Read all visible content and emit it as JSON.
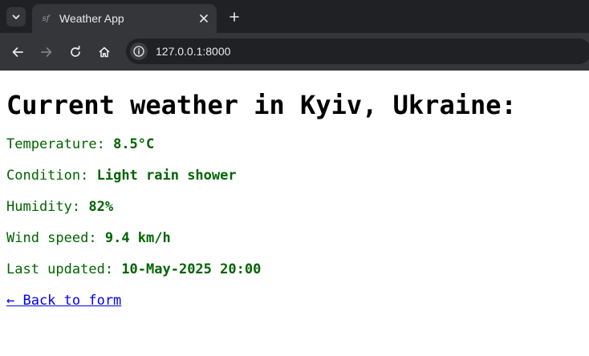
{
  "browser": {
    "tab_title": "Weather App",
    "favicon_text": "sf",
    "url": "127.0.0.1:8000",
    "icons": {
      "tab_search": "chevron-down-icon",
      "tab_close": "close-icon",
      "new_tab": "plus-icon",
      "back": "arrow-left-icon",
      "forward": "arrow-right-icon",
      "reload": "reload-icon",
      "home": "home-icon",
      "site_info": "info-icon"
    }
  },
  "page": {
    "heading": "Current weather in Kyiv, Ukraine:",
    "fields": [
      {
        "label": "Temperature:",
        "value": "8.5°C"
      },
      {
        "label": "Condition:",
        "value": "Light rain shower"
      },
      {
        "label": "Humidity:",
        "value": "82%"
      },
      {
        "label": "Wind speed:",
        "value": "9.4 km/h"
      },
      {
        "label": "Last updated:",
        "value": "10-May-2025 20:00"
      }
    ],
    "back_link": "← Back to form"
  },
  "colors": {
    "label_text": "#006400",
    "link": "#0000ee",
    "chrome_dark": "#202124",
    "chrome_mid": "#35363a"
  }
}
